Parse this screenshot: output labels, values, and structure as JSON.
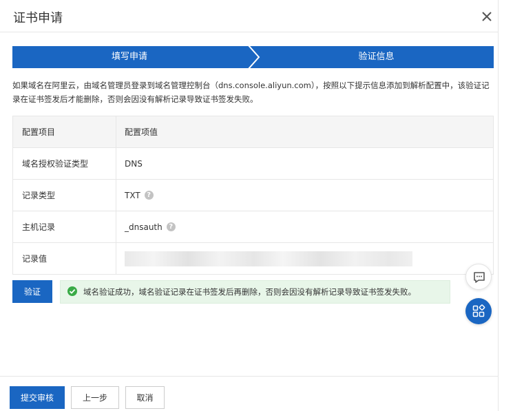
{
  "dialog": {
    "title": "证书申请",
    "close_icon": "close-icon"
  },
  "steps": [
    {
      "label": "填写申请"
    },
    {
      "label": "验证信息"
    }
  ],
  "description": "如果域名在阿里云，由域名管理员登录到域名管理控制台（dns.console.aliyun.com），按照以下提示信息添加到解析配置中，该验证记录在证书签发后才能删除，否则会因没有解析记录导致证书签发失败。",
  "table": {
    "headers": [
      "配置项目",
      "配置项值"
    ],
    "rows": [
      {
        "key": "域名授权验证类型",
        "value": "DNS"
      },
      {
        "key": "记录类型",
        "value": "TXT",
        "help": "?"
      },
      {
        "key": "主机记录",
        "value": "_dnsauth",
        "help": "?"
      },
      {
        "key": "记录值",
        "value": ""
      }
    ]
  },
  "verify": {
    "button_label": "验证",
    "success_message": "域名验证成功，域名验证记录在证书签发后再删除，否则会因没有解析记录导致证书签发失败。",
    "success_icon": "check-circle-icon"
  },
  "floating": {
    "chat_icon": "chat-icon",
    "apps_icon": "apps-icon"
  },
  "footer": {
    "submit_label": "提交审核",
    "prev_label": "上一步",
    "cancel_label": "取消"
  },
  "colors": {
    "primary": "#1a66c2",
    "success": "#3aab47"
  }
}
